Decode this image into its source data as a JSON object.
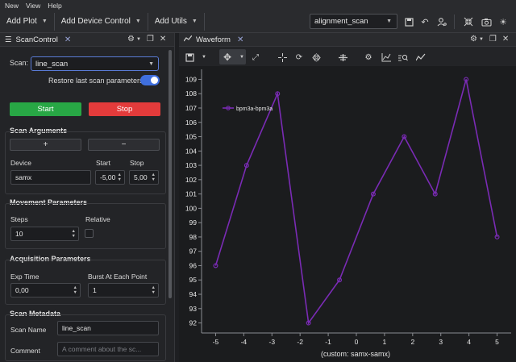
{
  "menu": {
    "items": [
      "New",
      "View",
      "Help"
    ]
  },
  "toolbar": {
    "add_plot": "Add Plot",
    "add_device_control": "Add Device Control",
    "add_utils": "Add Utils",
    "profile": "alignment_scan"
  },
  "scan_control": {
    "tab_title": "ScanControl",
    "scan_label": "Scan:",
    "scan_value": "line_scan",
    "restore_label": "Restore last scan parameters",
    "restore_on": true,
    "start_label": "Start",
    "stop_label": "Stop",
    "scan_args": {
      "title": "Scan Arguments",
      "add": "+",
      "remove": "−",
      "device_header": "Device",
      "start_header": "Start",
      "stop_header": "Stop",
      "device_value": "samx",
      "start_value": "-5,00",
      "stop_value": "5,00"
    },
    "movement": {
      "title": "Movement Parameters",
      "steps_label": "Steps",
      "relative_label": "Relative",
      "steps_value": "10",
      "relative_checked": false
    },
    "acquisition": {
      "title": "Acquisition Parameters",
      "exp_time_label": "Exp Time",
      "burst_label": "Burst At Each Point",
      "exp_time_value": "0,00",
      "burst_value": "1"
    },
    "metadata": {
      "title": "Scan Metadata",
      "scan_name_label": "Scan Name",
      "scan_name_value": "line_scan",
      "comment_label": "Comment",
      "comment_placeholder": "A comment about the sc..."
    }
  },
  "waveform": {
    "tab_title": "Waveform"
  },
  "chart_data": {
    "type": "line",
    "x": [
      -5,
      -3.9,
      -2.8,
      -1.7,
      -0.6,
      0.6,
      1.7,
      2.8,
      3.9,
      5
    ],
    "series": [
      {
        "name": "bpm3a-bpm3a",
        "values": [
          96,
          103,
          108,
          92,
          95,
          101,
          105,
          101,
          109,
          98
        ],
        "color": "#7a2bb5"
      }
    ],
    "xlabel": "(custom: samx-samx)",
    "ylabel": "",
    "xlim": [
      -5.5,
      5.5
    ],
    "ylim": [
      91.3,
      109.7
    ],
    "xticks": [
      -5,
      -4,
      -3,
      -2,
      -1,
      0,
      1,
      2,
      3,
      4,
      5
    ],
    "yticks": [
      92,
      93,
      94,
      95,
      96,
      97,
      98,
      99,
      100,
      101,
      102,
      103,
      104,
      105,
      106,
      107,
      108,
      109
    ],
    "grid": false,
    "legend": "top-left"
  }
}
